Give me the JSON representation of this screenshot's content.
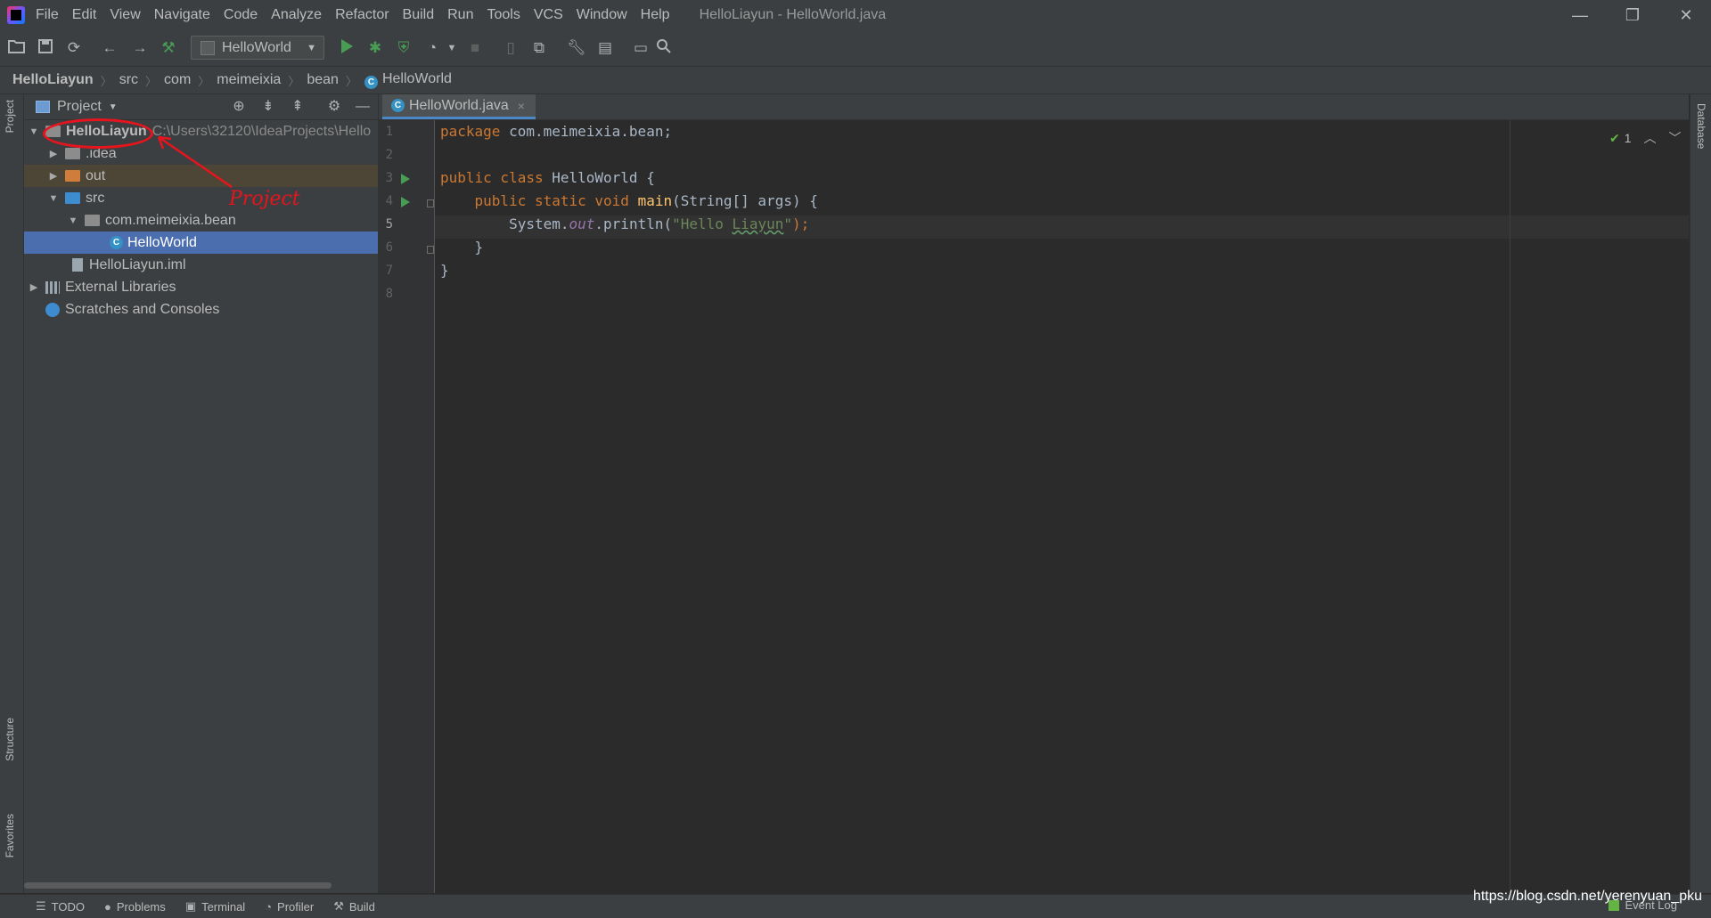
{
  "app": {
    "window_title": "HelloLiayun - HelloWorld.java",
    "logo_icon": "intellij-logo-icon"
  },
  "menu": [
    "File",
    "Edit",
    "View",
    "Navigate",
    "Code",
    "Analyze",
    "Refactor",
    "Build",
    "Run",
    "Tools",
    "VCS",
    "Window",
    "Help"
  ],
  "window_controls": {
    "minimize": "—",
    "restore": "❐",
    "close": "✕"
  },
  "toolbar": {
    "run_config": "HelloWorld",
    "icons": [
      "open-folder-icon",
      "save-icon",
      "sync-icon",
      "back-icon",
      "forward-icon",
      "build-hammer-icon",
      "run-icon",
      "debug-icon",
      "coverage-icon",
      "profile-icon",
      "stop-icon",
      "attach-icon",
      "sdk-icon",
      "wrench-icon",
      "project-structure-icon",
      "presentation-icon",
      "search-icon"
    ]
  },
  "breadcrumb": [
    "HelloLiayun",
    "src",
    "com",
    "meimeixia",
    "bean",
    "HelloWorld"
  ],
  "left_stripe": {
    "project": "Project",
    "structure": "Structure",
    "favorites": "Favorites"
  },
  "right_stripe": {
    "database": "Database"
  },
  "project_panel": {
    "title": "Project",
    "tree": [
      {
        "label": "HelloLiayun",
        "path": "C:\\Users\\32120\\IdeaProjects\\Hello"
      },
      {
        "label": ".idea"
      },
      {
        "label": "out"
      },
      {
        "label": "src"
      },
      {
        "label": "com.meimeixia.bean"
      },
      {
        "label": "HelloWorld"
      },
      {
        "label": "HelloLiayun.iml"
      },
      {
        "label": "External Libraries"
      },
      {
        "label": "Scratches and Consoles"
      }
    ]
  },
  "annotation": {
    "label": "Project",
    "color": "#e8141d"
  },
  "editor": {
    "tab_label": "HelloWorld.java",
    "tab_close": "×",
    "line_numbers": [
      "1",
      "2",
      "3",
      "4",
      "5",
      "6",
      "7",
      "8"
    ],
    "code": {
      "l1_kw": "package ",
      "l1_rest": "com.meimeixia.bean;",
      "l3_kw": "public class ",
      "l3_rest": "HelloWorld {",
      "l4_indent": "    ",
      "l4_kw": "public static void ",
      "l4_fn": "main",
      "l4_rest": "(String[] args) {",
      "l5_a": "        System.",
      "l5_field": "out",
      "l5_b": ".println(",
      "l5_str_a": "\"Hello ",
      "l5_str_typo": "Liayun",
      "l5_str_b": "\"",
      "l5_c": ");",
      "l6": "    }",
      "l7": "}"
    },
    "inspection_count": "1",
    "current_line": 5
  },
  "status_bar": {
    "items": [
      "TODO",
      "Problems",
      "Terminal",
      "Profiler",
      "Build"
    ],
    "event_log": "Event Log"
  },
  "watermark": "https://blog.csdn.net/yerenyuan_pku"
}
